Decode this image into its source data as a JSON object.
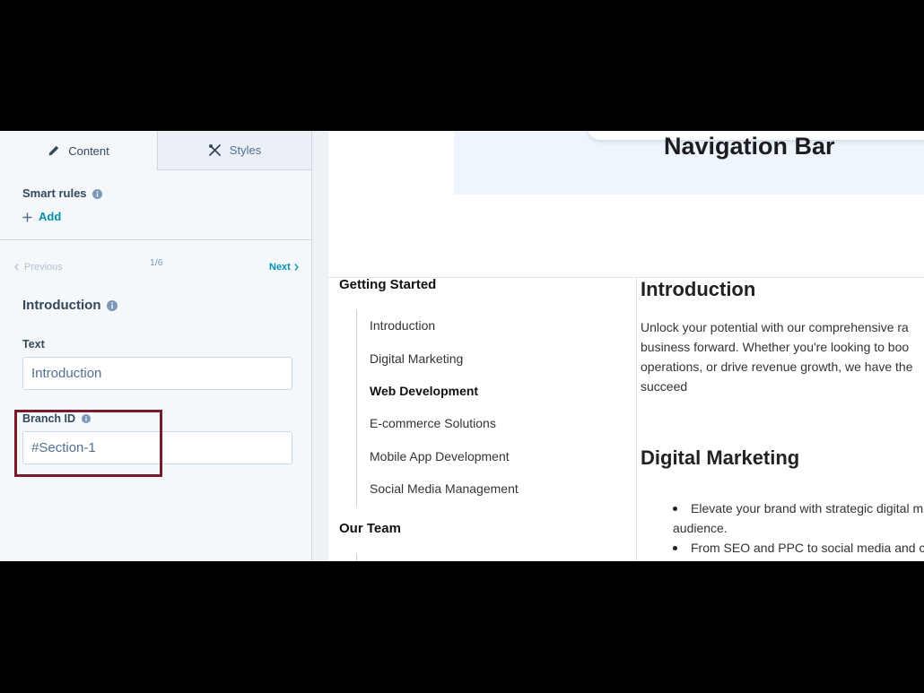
{
  "sidebar": {
    "active_tab_index": 0,
    "tabs": [
      {
        "label": "Content",
        "icon": "pencil-icon"
      },
      {
        "label": "Styles",
        "icon": "tools-icon"
      }
    ],
    "smart_rules": {
      "label": "Smart rules",
      "add_label": "Add"
    },
    "pager": {
      "previous_label": "Previous",
      "position": "1/6",
      "next_label": "Next"
    },
    "section_title": "Introduction",
    "fields": {
      "text": {
        "label": "Text",
        "value": "Introduction"
      },
      "branch_id": {
        "label": "Branch ID",
        "value": "#Section-1"
      }
    }
  },
  "preview": {
    "nav_heading": "Navigation Bar",
    "toc": {
      "active_item_index": 2,
      "groups": [
        {
          "title": "Getting Started",
          "items": [
            "Introduction",
            "Digital Marketing",
            "Web Development",
            "E-commerce Solutions",
            "Mobile App Development",
            "Social Media Management"
          ]
        },
        {
          "title": "Our Team"
        }
      ]
    },
    "sections": [
      {
        "heading": "Introduction",
        "lines": [
          "Unlock your potential with our comprehensive ra",
          "business forward. Whether you're looking to boo",
          "operations, or drive revenue growth, we have the",
          "succeed"
        ]
      },
      {
        "heading": "Digital Marketing",
        "bullets": [
          {
            "lines": [
              "Elevate your brand with strategic digital m",
              "audience."
            ]
          },
          {
            "lines": [
              "From SEO and PPC to social media and c"
            ]
          }
        ]
      }
    ]
  },
  "colors": {
    "accent": "#0091ae",
    "annotation": "#7b1a2c",
    "sidebar-bg": "#f5f8fa",
    "tab-inactive": "#eaf0f6",
    "border": "#cbd6e2",
    "text": "#33475b",
    "disabled": "#b0c1d4",
    "nav-box-bg": "#eef5fc"
  }
}
